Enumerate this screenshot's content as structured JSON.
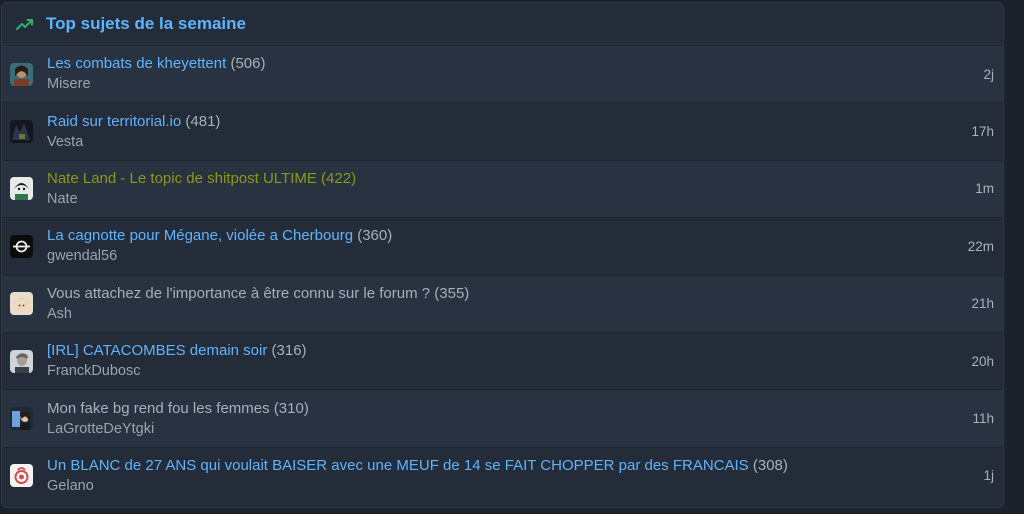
{
  "header": {
    "title": "Top sujets de la semaine",
    "icon": "trending-up-icon",
    "accent": "#5fb4ff",
    "icon_color": "#28b463"
  },
  "topics": [
    {
      "subject": "Les combats de kheyettent",
      "count": "(506)",
      "author": "Misere",
      "time": "2j",
      "avatar": "avatar-misere",
      "state": "unread"
    },
    {
      "subject": "Raid sur territorial.io",
      "count": "(481)",
      "author": "Vesta",
      "time": "17h",
      "avatar": "avatar-vesta",
      "state": "unread"
    },
    {
      "subject": "Nate Land - Le topic de shitpost ULTIME",
      "count": "(422)",
      "author": "Nate",
      "time": "1m",
      "avatar": "avatar-nate",
      "state": "highlighted"
    },
    {
      "subject": "La cagnotte pour Mégane, violée a Cherbourg",
      "count": "(360)",
      "author": "gwendal56",
      "time": "22m",
      "avatar": "avatar-gwendal56",
      "state": "unread"
    },
    {
      "subject": "Vous attachez de l'importance à être connu sur le forum ?",
      "count": "(355)",
      "author": "Ash",
      "time": "21h",
      "avatar": "avatar-ash",
      "state": "read"
    },
    {
      "subject": "[IRL] CATACOMBES demain soir",
      "count": "(316)",
      "author": "FranckDubosc",
      "time": "20h",
      "avatar": "avatar-franckdubosc",
      "state": "unread"
    },
    {
      "subject": "Mon fake bg rend fou les femmes",
      "count": "(310)",
      "author": "LaGrotteDeYtgki",
      "time": "11h",
      "avatar": "avatar-lagrottedeytgki",
      "state": "read"
    },
    {
      "subject": "Un BLANC de 27 ANS qui voulait BAISER avec une MEUF de 14 se FAIT CHOPPER par des FRANCAIS",
      "count": "(308)",
      "author": "Gelano",
      "time": "1j",
      "avatar": "avatar-gelano",
      "state": "unread"
    }
  ]
}
